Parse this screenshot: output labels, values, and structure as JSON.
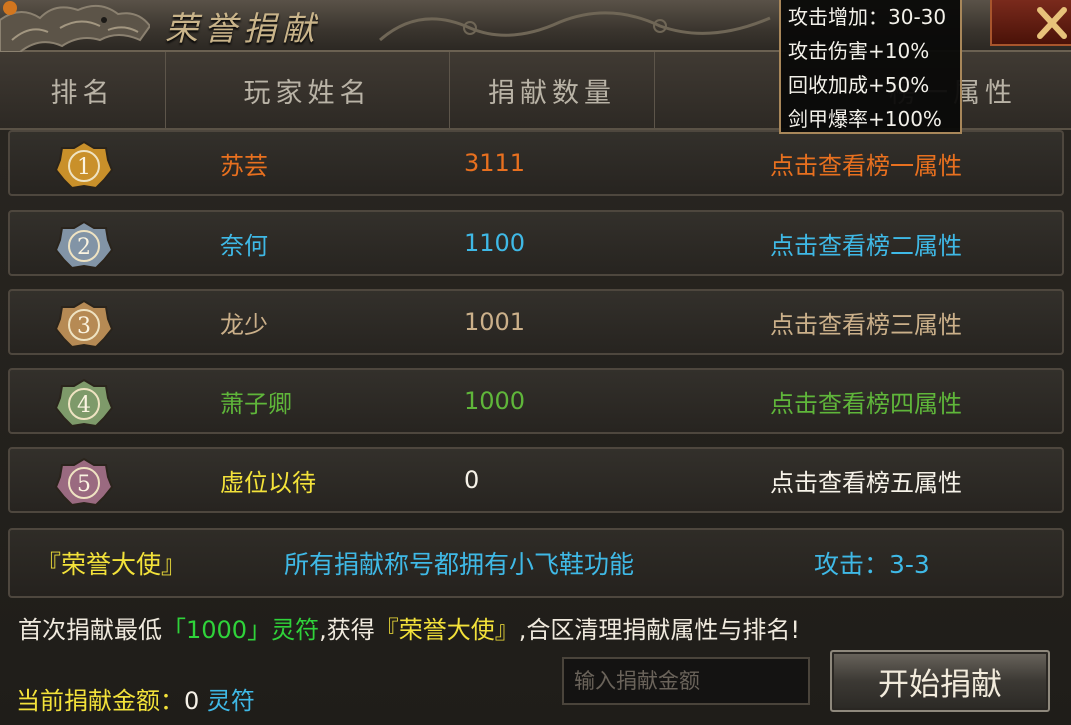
{
  "window": {
    "title": "荣誉捐献"
  },
  "table": {
    "headers": [
      "排名",
      "玩家姓名",
      "捐献数量",
      "榜一属性"
    ],
    "rows": [
      {
        "rank": "1",
        "name": "苏芸",
        "amount": "3111",
        "attr": "点击查看榜一属性",
        "color": "#e8701f",
        "medal": "#c9902a"
      },
      {
        "rank": "2",
        "name": "奈何",
        "amount": "1100",
        "attr": "点击查看榜二属性",
        "color": "#3fb9e6",
        "medal": "#8294a6"
      },
      {
        "rank": "3",
        "name": "龙少",
        "amount": "1001",
        "attr": "点击查看榜三属性",
        "color": "#cbb08a",
        "medal": "#b68a54"
      },
      {
        "rank": "4",
        "name": "萧子卿",
        "amount": "1000",
        "attr": "点击查看榜四属性",
        "color": "#5fb63a",
        "medal": "#7e9a6a"
      },
      {
        "rank": "5",
        "name": "虚位以待",
        "amount": "0",
        "attr": "点击查看榜五属性",
        "color": "#f6f2e8",
        "name_color": "#f3e23a",
        "medal": "#9a6a80"
      }
    ]
  },
  "info_row": {
    "title": "『荣誉大使』",
    "desc": "所有捐献称号都拥有小飞鞋功能",
    "stat": "攻击：3-3"
  },
  "tooltip": {
    "lines": [
      "攻击增加：30-30",
      "攻击伤害+10%",
      "回收加成+50%",
      "剑甲爆率+100%"
    ]
  },
  "notice": {
    "part1": "首次捐献最低",
    "amount": "「1000」灵符",
    "part2": ",获得",
    "title": "『荣誉大使』",
    "part3": ",合区清理捐献属性与排名!"
  },
  "donation": {
    "input_placeholder": "输入捐献金额",
    "button_label": "开始捐献",
    "current_label": "当前捐献金额：",
    "current_value": "0",
    "current_unit": "灵符"
  },
  "colors": {
    "gold": "#f3e23a",
    "cyan": "#3fb9e6",
    "green": "#2fd33a",
    "orange": "#e8701f"
  }
}
